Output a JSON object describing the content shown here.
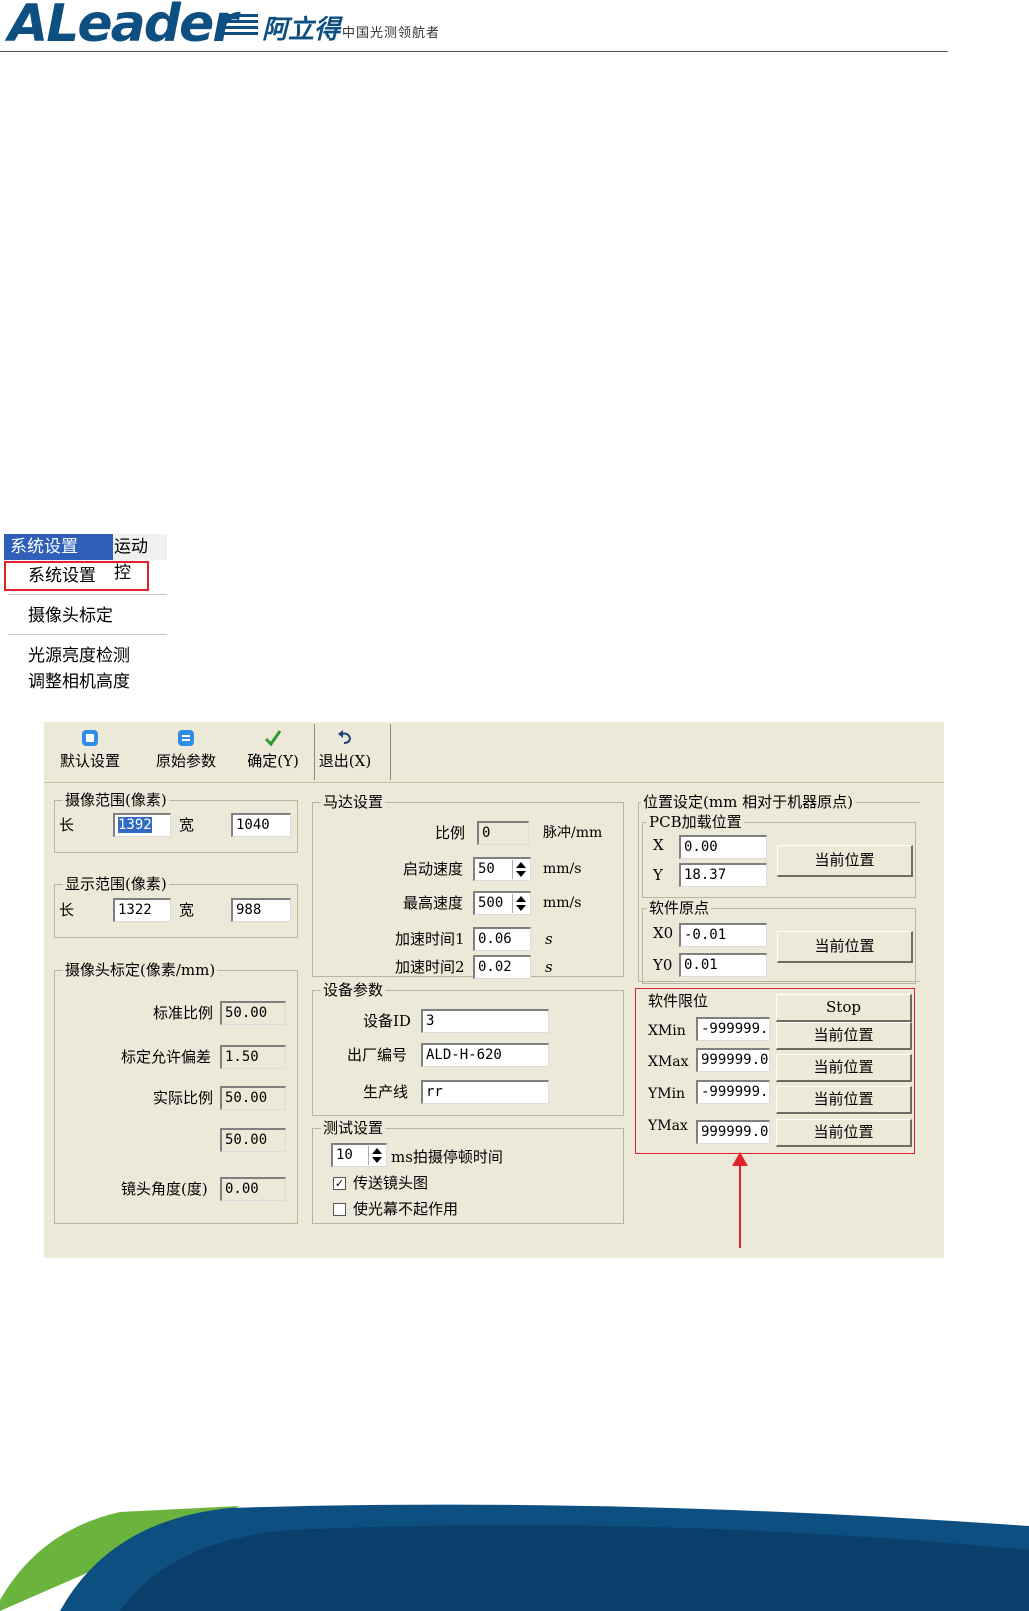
{
  "header": {
    "logo_text": "ALeader",
    "logo_cn": "阿立得",
    "tagline": "中国光测领航者",
    "brand_color": "#0e4f82"
  },
  "menu": {
    "menubar": [
      "系统设置",
      "运动控"
    ],
    "items": [
      "系统设置",
      "摄像头标定",
      "光源亮度检测",
      "调整相机高度"
    ],
    "selected_bg": "#2f5fb8",
    "highlight_color": "#e0222a"
  },
  "toolbar": {
    "default_settings": "默认设置",
    "original_params": "原始参数",
    "confirm": "确定(Y)",
    "exit": "退出(X)"
  },
  "camera_range": {
    "title": "摄像范围(像素)",
    "length_label": "长",
    "length_value": "1392",
    "width_label": "宽",
    "width_value": "1040"
  },
  "display_range": {
    "title": "显示范围(像素)",
    "length_label": "长",
    "length_value": "1322",
    "width_label": "宽",
    "width_value": "988"
  },
  "camera_calib": {
    "title": "摄像头标定(像素/mm)",
    "std_ratio_label": "标准比例",
    "std_ratio_value": "50.00",
    "tolerance_label": "标定允许偏差",
    "tolerance_value": "1.50",
    "actual_ratio_label": "实际比例",
    "actual_ratio_value": "50.00",
    "actual_ratio_value2": "50.00",
    "lens_angle_label": "镜头角度(度)",
    "lens_angle_value": "0.00"
  },
  "motor": {
    "title": "马达设置",
    "ratio_label": "比例",
    "ratio_value": "0",
    "ratio_unit": "脉冲/mm",
    "start_speed_label": "启动速度",
    "start_speed_value": "50",
    "start_speed_unit": "mm/s",
    "max_speed_label": "最高速度",
    "max_speed_value": "500",
    "max_speed_unit": "mm/s",
    "accel1_label": "加速时间1",
    "accel1_value": "0.06",
    "accel1_unit": "s",
    "accel2_label": "加速时间2",
    "accel2_value": "0.02",
    "accel2_unit": "s"
  },
  "device": {
    "title": "设备参数",
    "id_label": "设备ID",
    "id_value": "3",
    "serial_label": "出厂编号",
    "serial_value": "ALD-H-620",
    "line_label": "生产线",
    "line_value": "rr"
  },
  "test": {
    "title": "测试设置",
    "pause_value": "10",
    "pause_label": "ms拍摄停顿时间",
    "transfer_label": "传送镜头图",
    "transfer_checked": "✓",
    "curtain_label": "使光幕不起作用"
  },
  "position": {
    "title": "位置设定(mm 相对于机器原点)",
    "pcb_title": "PCB加载位置",
    "x_label": "X",
    "x_value": "0.00",
    "y_label": "Y",
    "y_value": "18.37",
    "current_pos": "当前位置",
    "origin_title": "软件原点",
    "x0_label": "X0",
    "x0_value": "-0.01",
    "y0_label": "Y0",
    "y0_value": "0.01",
    "limit_title": "软件限位",
    "stop_label": "Stop",
    "xmin_label": "XMin",
    "xmin_value": "-999999.",
    "xmax_label": "XMax",
    "xmax_value": "999999.0",
    "ymin_label": "YMin",
    "ymin_value": "-999999.",
    "ymax_label": "YMax",
    "ymax_value": "999999.0"
  }
}
